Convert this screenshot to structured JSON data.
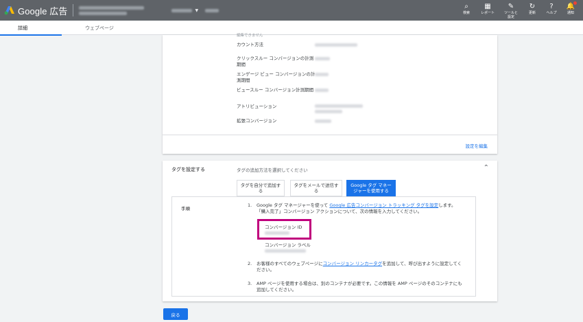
{
  "app": {
    "logo_text": "Google 広告"
  },
  "toolbar": [
    {
      "icon": "search-icon",
      "glyph": "⌕",
      "label": "検索"
    },
    {
      "icon": "reports-icon",
      "glyph": "▦",
      "label": "レポート"
    },
    {
      "icon": "tools-icon",
      "glyph": "✎",
      "label": "ツールと\n設定"
    },
    {
      "icon": "refresh-icon",
      "glyph": "↻",
      "label": "更新"
    },
    {
      "icon": "help-icon",
      "glyph": "?",
      "label": "ヘルプ"
    },
    {
      "icon": "notifications-icon",
      "glyph": "🔔",
      "label": "通知"
    }
  ],
  "tabs": {
    "details": "詳細",
    "webpage": "ウェブページ"
  },
  "settings": {
    "truncated_top": "編集できません",
    "fields": [
      "カウント方法",
      "クリックスルー コンバージョンの計測期間",
      "エンゲージ ビュー コンバージョンの計測期間",
      "ビュースルー コンバージョン計測期間",
      "アトリビューション",
      "拡張コンバージョン"
    ],
    "edit_link": "設定を編集"
  },
  "tag_setup": {
    "title": "タグを設定する",
    "subtitle": "タグの追加方法を選択してください",
    "options": [
      "タグを自分で追加する",
      "タグをメールで送信する",
      "Google タグ マネージャーを使用する"
    ],
    "steps_heading": "手順",
    "step1": {
      "num": "1.",
      "pre": "Google タグ マネージャーを使って ",
      "link": "Google 広告コンバージョン トラッキング タグを設定",
      "post": "します。「購入完了」コンバージョン アクションについて、次の情報を入力してください。"
    },
    "conversion_id_label": "コンバージョン ID",
    "conversion_label_label": "コンバージョン ラベル",
    "step2": {
      "num": "2.",
      "pre": "お客様のすべてのウェブページに",
      "link": "コンバージョン リンカータグ",
      "post": "を追加して、呼び出すように設定してください。"
    },
    "step3": {
      "num": "3.",
      "text": "AMP ページを使用する場合は、別のコンテナが必要です。この情報を AMP ページのそのコンテナにも追加してください。"
    }
  },
  "back_button": "戻る",
  "colors": {
    "accent": "#1a73e8",
    "highlight": "#c0007d",
    "topbar": "#5f6368"
  }
}
